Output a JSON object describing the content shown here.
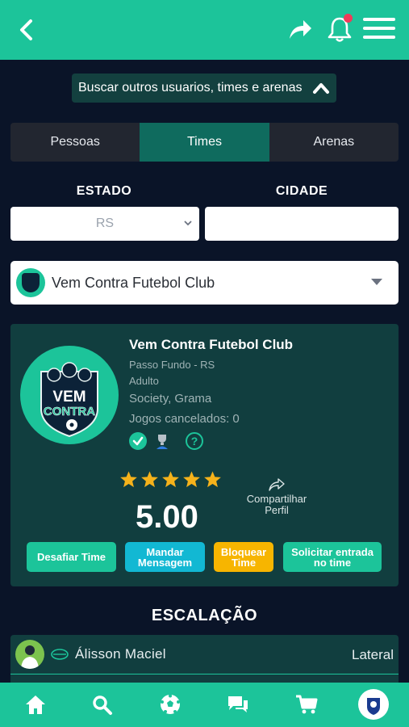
{
  "header": {
    "back_icon": "chevron-left-icon",
    "share_icon": "share-arrow-icon",
    "bell_icon": "bell-icon",
    "menu_icon": "hamburger-menu-icon",
    "notification_dot_color": "#ef3b5a"
  },
  "search_toggle": {
    "label": "Buscar outros usuarios, times e arenas"
  },
  "tabs": [
    {
      "label": "Pessoas",
      "active": false
    },
    {
      "label": "Times",
      "active": true
    },
    {
      "label": "Arenas",
      "active": false
    }
  ],
  "filters": {
    "estado_label": "ESTADO",
    "estado_value": "RS",
    "cidade_label": "CIDADE",
    "cidade_value": ""
  },
  "team_select": {
    "selected": "Vem Contra Futebol Club"
  },
  "team": {
    "name": "Vem Contra Futebol Club",
    "location": "Passo Fundo - RS",
    "category": "Adulto",
    "surface": "Society, Grama",
    "cancelled_games": "Jogos cancelados: 0",
    "logo_text_top": "VEM",
    "logo_text_bottom": "CONTRA",
    "rating": "5.00",
    "stars": 5,
    "share_label_1": "Compartilhar",
    "share_label_2": "Perfil"
  },
  "actions": {
    "challenge": "Desafiar Time",
    "message_1": "Mandar",
    "message_2": "Mensagem",
    "block_1": "Bloquear",
    "block_2": "Time",
    "request_1": "Solicitar entrada",
    "request_2": "no time"
  },
  "lineup": {
    "title": "ESCALAÇÃO",
    "players": [
      {
        "name": "Álisson  Maciel",
        "position": "Lateral"
      }
    ]
  },
  "bottom_nav": [
    "home-icon",
    "search-icon",
    "soccer-ball-icon",
    "chat-icon",
    "cart-icon",
    "profile-icon"
  ],
  "colors": {
    "primary": "#1cc49a",
    "background": "#0a1428",
    "card": "#113e3f",
    "message_button": "#12b8d3",
    "block_button": "#f7b500",
    "star": "#f5b21b"
  }
}
